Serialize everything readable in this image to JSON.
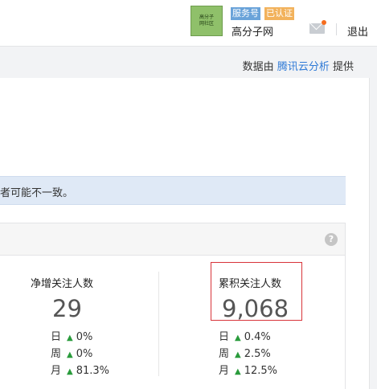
{
  "header": {
    "logo_text_line1": "高分子",
    "logo_text_line2": "网社区",
    "badge_service": "服务号",
    "badge_verified": "已认证",
    "account_name": "高分子网",
    "logout": "退出",
    "colors": {
      "service_badge": "#6aa3d9",
      "verified_badge": "#f2b25c",
      "notification_dot": "#f56c1e"
    }
  },
  "provider": {
    "prefix": "数据由",
    "link": "腾讯云分析",
    "suffix": "提供"
  },
  "notice": {
    "text": "者可能不一致。"
  },
  "stats": {
    "help_icon": "?",
    "metrics": [
      {
        "title": "净增关注人数",
        "value": "29",
        "changes": [
          {
            "label": "日",
            "direction": "up",
            "value": "0%"
          },
          {
            "label": "周",
            "direction": "up",
            "value": "0%"
          },
          {
            "label": "月",
            "direction": "up",
            "value": "81.3%"
          }
        ]
      },
      {
        "title": "累积关注人数",
        "value": "9,068",
        "changes": [
          {
            "label": "日",
            "direction": "up",
            "value": "0.4%"
          },
          {
            "label": "周",
            "direction": "up",
            "value": "2.5%"
          },
          {
            "label": "月",
            "direction": "up",
            "value": "12.5%"
          }
        ]
      }
    ],
    "colors": {
      "up_arrow": "#2a9b3c",
      "highlight_border": "#d8343a"
    }
  }
}
